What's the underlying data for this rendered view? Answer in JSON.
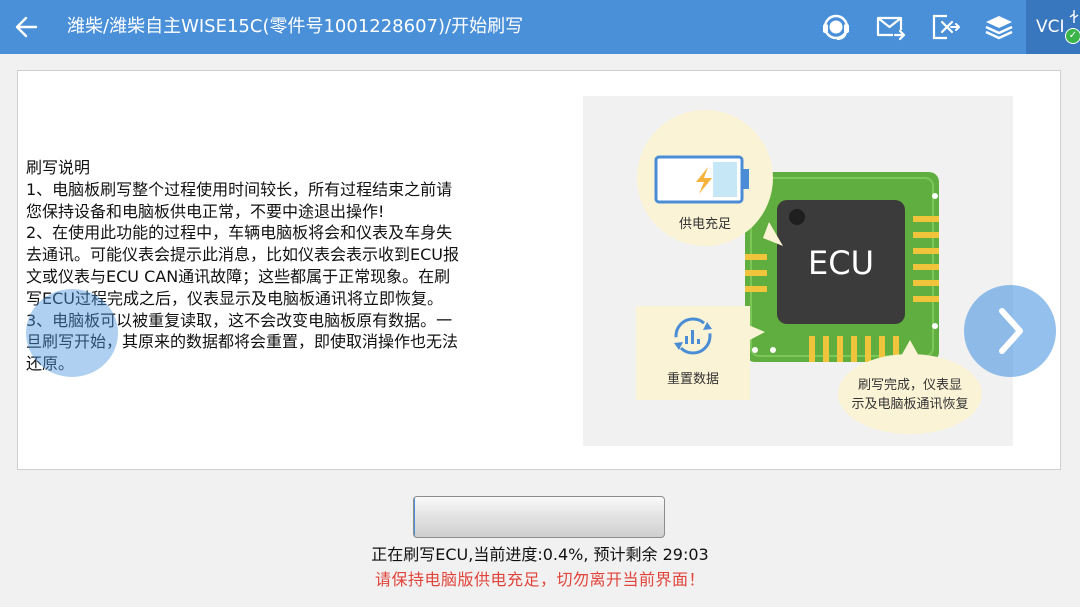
{
  "header": {
    "title": "潍柴/潍柴自主WISE15C(零件号1001228607)/开始刷写",
    "icons": [
      "back-arrow-icon",
      "headset-support-icon",
      "mail-forward-icon",
      "export-icon",
      "layers-icon"
    ],
    "vci_label": "VCI",
    "vci_status": "connected"
  },
  "description": {
    "heading": "刷写说明",
    "lines": [
      " 1、电脑板刷写整个过程使用时间较长，所有过程结束之前请",
      "您保持设备和电脑板供电正常，不要中途退出操作!",
      " 2、在使用此功能的过程中，车辆电脑板将会和仪表及车身失",
      "去通讯。可能仪表会提示此消息，比如仪表会表示收到ECU报",
      "文或仪表与ECU CAN通讯故障；这些都属于正常现象。在刷",
      "写ECU过程完成之后，仪表显示及电脑板通讯将立即恢复。",
      " 3、电脑板可以被重复读取，这不会改变电脑板原有数据。一",
      "旦刷写开始，其原来的数据都将会重置，即使取消操作也无法",
      "还原。"
    ]
  },
  "illustration": {
    "chip_label": "ECU",
    "bubble_power": "供电充足",
    "bubble_reset": "重置数据",
    "bubble_done_line1": "刷写完成，仪表显",
    "bubble_done_line2": "示及电脑板通讯恢复"
  },
  "progress": {
    "percent": 0.4,
    "status_text": "正在刷写ECU,当前进度:0.4%, 预计剩余 29:03",
    "warning_text": "请保持电脑版供电充足，切勿离开当前界面！"
  },
  "colors": {
    "topbar": "#4a90d9",
    "vci_box": "#3876bd",
    "pcb_green": "#5fae3f",
    "chip": "#3b3b3b",
    "warning": "#e0443a"
  }
}
